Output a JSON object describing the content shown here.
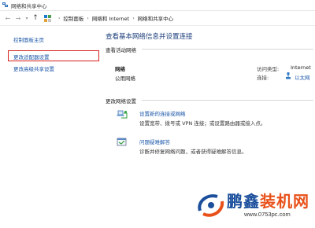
{
  "window": {
    "title": "网络和共享中心"
  },
  "address": {
    "crumbs": [
      "控制面板",
      "网络和 Internet",
      "网络和共享中心"
    ]
  },
  "sidebar": {
    "items": [
      {
        "label": "控制面板主页"
      },
      {
        "label": "更改适配器设置",
        "highlighted": true
      },
      {
        "label": "更改高级共享设置"
      }
    ]
  },
  "main": {
    "title": "查看基本网络信息并设置连接",
    "active_section": "查看活动网络",
    "network": {
      "name": "网络",
      "category": "公用网络",
      "access_type_label": "访问类型:",
      "access_type_value": "Internet",
      "connection_label": "连接:",
      "connection_value": "以太网"
    },
    "change_section": "更改网络设置",
    "tasks": [
      {
        "title": "设置新的连接或网络",
        "desc": "设置宽带、拨号或 VPN 连接；或设置路由器或接入点。",
        "icon": "new-connection-icon"
      },
      {
        "title": "问题疑难解答",
        "desc": "诊断并修复网络问题，或者获得疑难解答信息。",
        "icon": "troubleshoot-icon"
      }
    ]
  },
  "watermark": {
    "text_part1": "鹏鑫",
    "text_part2": "装机网",
    "url": "www.0753pc.com"
  },
  "colors": {
    "link": "#1a56a8",
    "title": "#1d3f7c",
    "highlight": "#d8201b",
    "watermark_blue": "#1b4f9c",
    "watermark_orange": "#e8511a"
  }
}
